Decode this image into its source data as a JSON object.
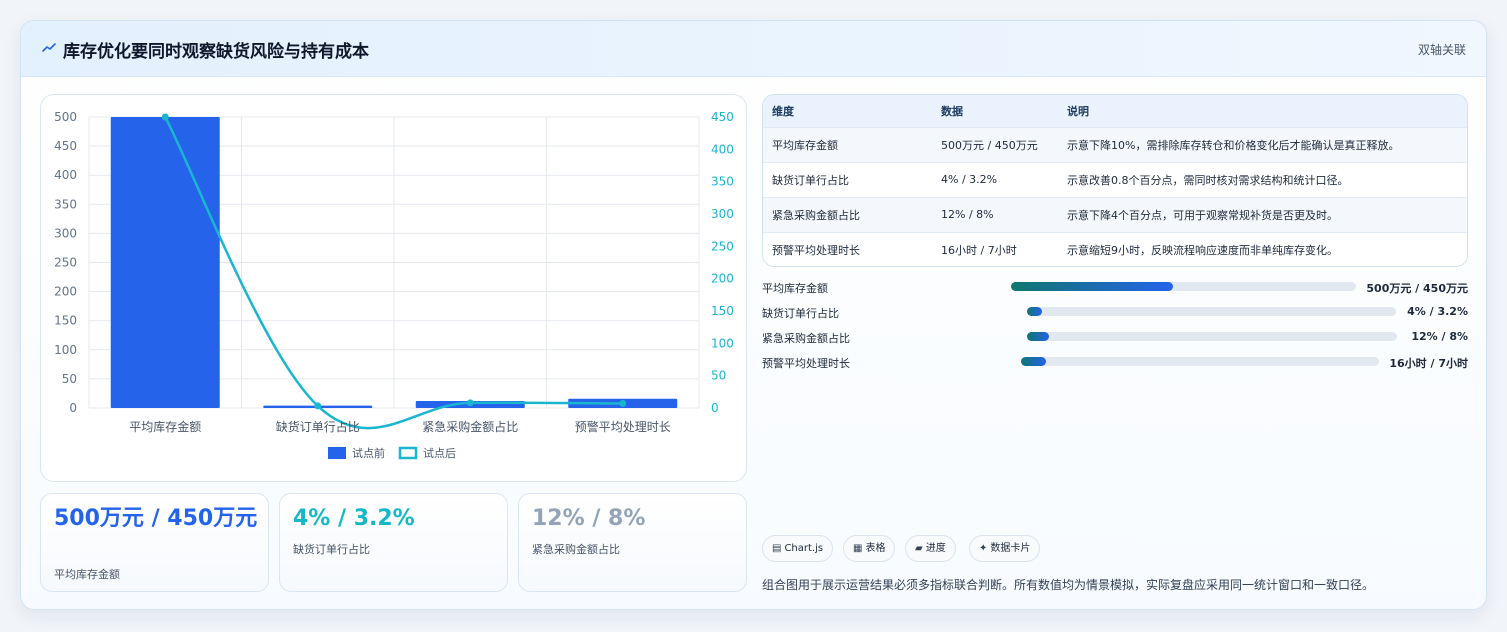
{
  "header": {
    "title": "库存优化要同时观察缺货风险与持有成本",
    "tag": "双轴关联"
  },
  "chart_data": {
    "type": "bar",
    "categories": [
      "平均库存金额",
      "缺货订单行占比",
      "紧急采购金额占比",
      "预警平均处理时长"
    ],
    "series": [
      {
        "name": "试点前",
        "type": "bar",
        "axis": "left",
        "values": [
          500,
          4,
          12,
          16
        ],
        "color": "#2563eb"
      },
      {
        "name": "试点后",
        "type": "line",
        "axis": "right",
        "values": [
          450,
          3.2,
          8,
          7
        ],
        "color": "#1ab6cf"
      }
    ],
    "y_left": {
      "min": 0,
      "max": 500,
      "ticks": [
        0,
        50,
        100,
        150,
        200,
        250,
        300,
        350,
        400,
        450,
        500
      ]
    },
    "y_right": {
      "min": 0,
      "max": 450,
      "ticks": [
        0,
        50,
        100,
        150,
        200,
        250,
        300,
        350,
        400,
        450
      ]
    },
    "grid": true,
    "legend_position": "bottom"
  },
  "kpis": [
    {
      "value": "500万元 / 450万元",
      "label": "平均库存金额",
      "color": "#2563eb"
    },
    {
      "value": "4% / 3.2%",
      "label": "缺货订单行占比",
      "color": "#14b8c8"
    },
    {
      "value": "12% / 8%",
      "label": "紧急采购金额占比",
      "color": "#94a3b8"
    }
  ],
  "table": {
    "headers": [
      "维度",
      "数据",
      "说明"
    ],
    "rows": [
      [
        "平均库存金额",
        "500万元 / 450万元",
        "示意下降10%，需排除库存转仓和价格变化后才能确认是真正释放。"
      ],
      [
        "缺货订单行占比",
        "4% / 3.2%",
        "示意改善0.8个百分点，需同时核对需求结构和统计口径。"
      ],
      [
        "紧急采购金额占比",
        "12% / 8%",
        "示意下降4个百分点，可用于观察常规补货是否更及时。"
      ],
      [
        "预警平均处理时长",
        "16小时 / 7小时",
        "示意缩短9小时，反映流程响应速度而非单纯库存变化。"
      ]
    ]
  },
  "progress": [
    {
      "label": "平均库存金额",
      "value": "500万元 / 450万元",
      "fill_fraction": 0.47
    },
    {
      "label": "缺货订单行占比",
      "value": "4% / 3.2%",
      "fill_fraction": 0.04
    },
    {
      "label": "紧急采购金额占比",
      "value": "12% / 8%",
      "fill_fraction": 0.06
    },
    {
      "label": "预警平均处理时长",
      "value": "16小时 / 7小时",
      "fill_fraction": 0.07
    }
  ],
  "chips": [
    {
      "icon": "▤",
      "label": "Chart.js"
    },
    {
      "icon": "▦",
      "label": "表格"
    },
    {
      "icon": "▰",
      "label": "进度"
    },
    {
      "icon": "✦",
      "label": "数据卡片"
    }
  ],
  "note": "组合图用于展示运营结果必须多指标联合判断。所有数值均为情景模拟，实际复盘应采用同一统计窗口和一致口径。"
}
